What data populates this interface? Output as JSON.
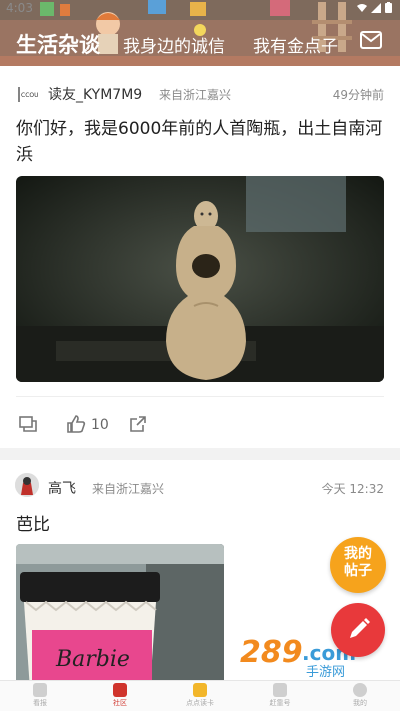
{
  "status_bar": {
    "time": "4:03"
  },
  "header": {
    "tabs": [
      {
        "label": "生活杂谈",
        "active": true
      },
      {
        "label": "我身边的诚信",
        "active": false
      },
      {
        "label": "我有金点子",
        "active": false
      }
    ],
    "mail_icon": "mail-icon"
  },
  "posts": [
    {
      "user": "读友_KYM7M9",
      "from": "来自浙江嘉兴",
      "time": "49分钟前",
      "title": "你们好，我是6000年前的人首陶瓶，出土自南河浜",
      "likes": "10"
    },
    {
      "user": "高飞",
      "from": "来自浙江嘉兴",
      "time": "今天 12:32",
      "title": "芭比"
    }
  ],
  "fab": {
    "label_line1": "我的",
    "label_line2": "帖子"
  },
  "watermark": {
    "number": "289",
    "suffix": ".com",
    "sub": "手游网"
  },
  "bottom_nav": [
    {
      "label": "看报",
      "icon": "newspaper-icon"
    },
    {
      "label": "社区",
      "icon": "community-icon",
      "active": true
    },
    {
      "label": "点点读卡",
      "icon": "card-icon"
    },
    {
      "label": "赶靠号",
      "icon": "account-icon"
    },
    {
      "label": "我的",
      "icon": "profile-icon"
    }
  ],
  "colors": {
    "accent_red": "#e8393b",
    "accent_yellow": "#f6a31c",
    "header_brown": "#a36f58"
  }
}
